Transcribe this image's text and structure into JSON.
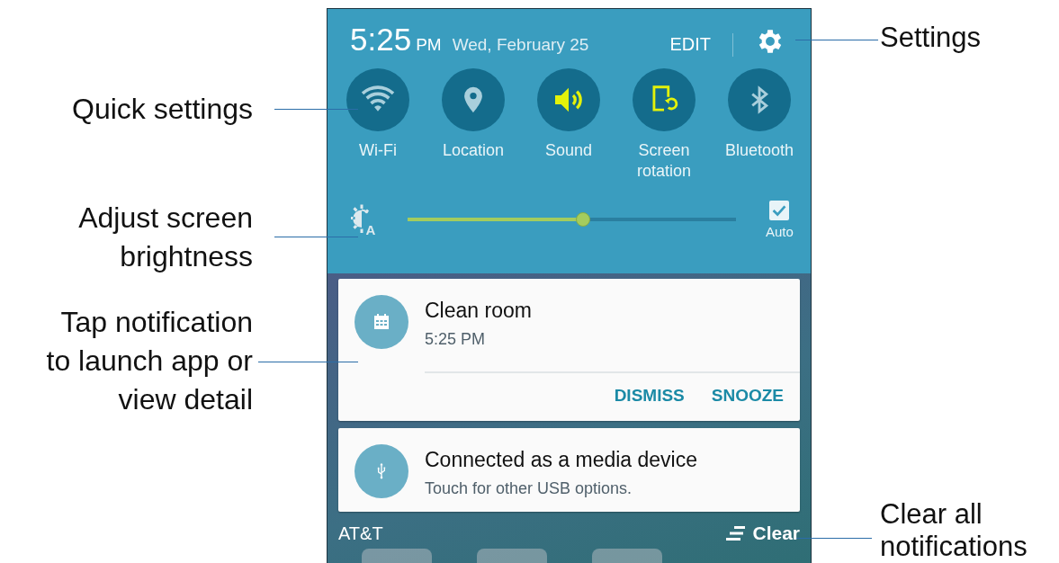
{
  "callouts_left": [
    {
      "kind": "quick",
      "lines": [
        "Quick settings"
      ]
    },
    {
      "kind": "brightness",
      "lines": [
        "Adjust screen",
        "brightness"
      ]
    },
    {
      "kind": "notification",
      "lines": [
        "Tap notification",
        "to launch app or",
        "view detail"
      ]
    }
  ],
  "callouts_right": [
    {
      "kind": "settings",
      "lines": [
        "Settings"
      ]
    },
    {
      "kind": "clear",
      "lines": [
        "Clear all",
        "notifications"
      ]
    }
  ],
  "header": {
    "time": "5:25",
    "ampm": "PM",
    "date": "Wed, February 25",
    "edit": "EDIT"
  },
  "toggles": [
    {
      "kind": "wifi",
      "label": "Wi-Fi",
      "on": false
    },
    {
      "kind": "location",
      "label": "Location",
      "on": false
    },
    {
      "kind": "sound",
      "label": "Sound",
      "on": true
    },
    {
      "kind": "rotation",
      "label": "Screen rotation",
      "on": true
    },
    {
      "kind": "bluetooth",
      "label": "Bluetooth",
      "on": false
    }
  ],
  "brightness": {
    "icon_letter": "A",
    "level": 0.52,
    "auto": {
      "label": "Auto",
      "checked": true
    }
  },
  "notifications": [
    {
      "kind": "calendar",
      "title": "Clean room",
      "subtitle": "5:25 PM",
      "actions": [
        "DISMISS",
        "SNOOZE"
      ]
    },
    {
      "kind": "usb",
      "title": "Connected as a media device",
      "subtitle": "Touch for other USB options."
    }
  ],
  "footer": {
    "carrier": "AT&T",
    "clear": "Clear"
  }
}
